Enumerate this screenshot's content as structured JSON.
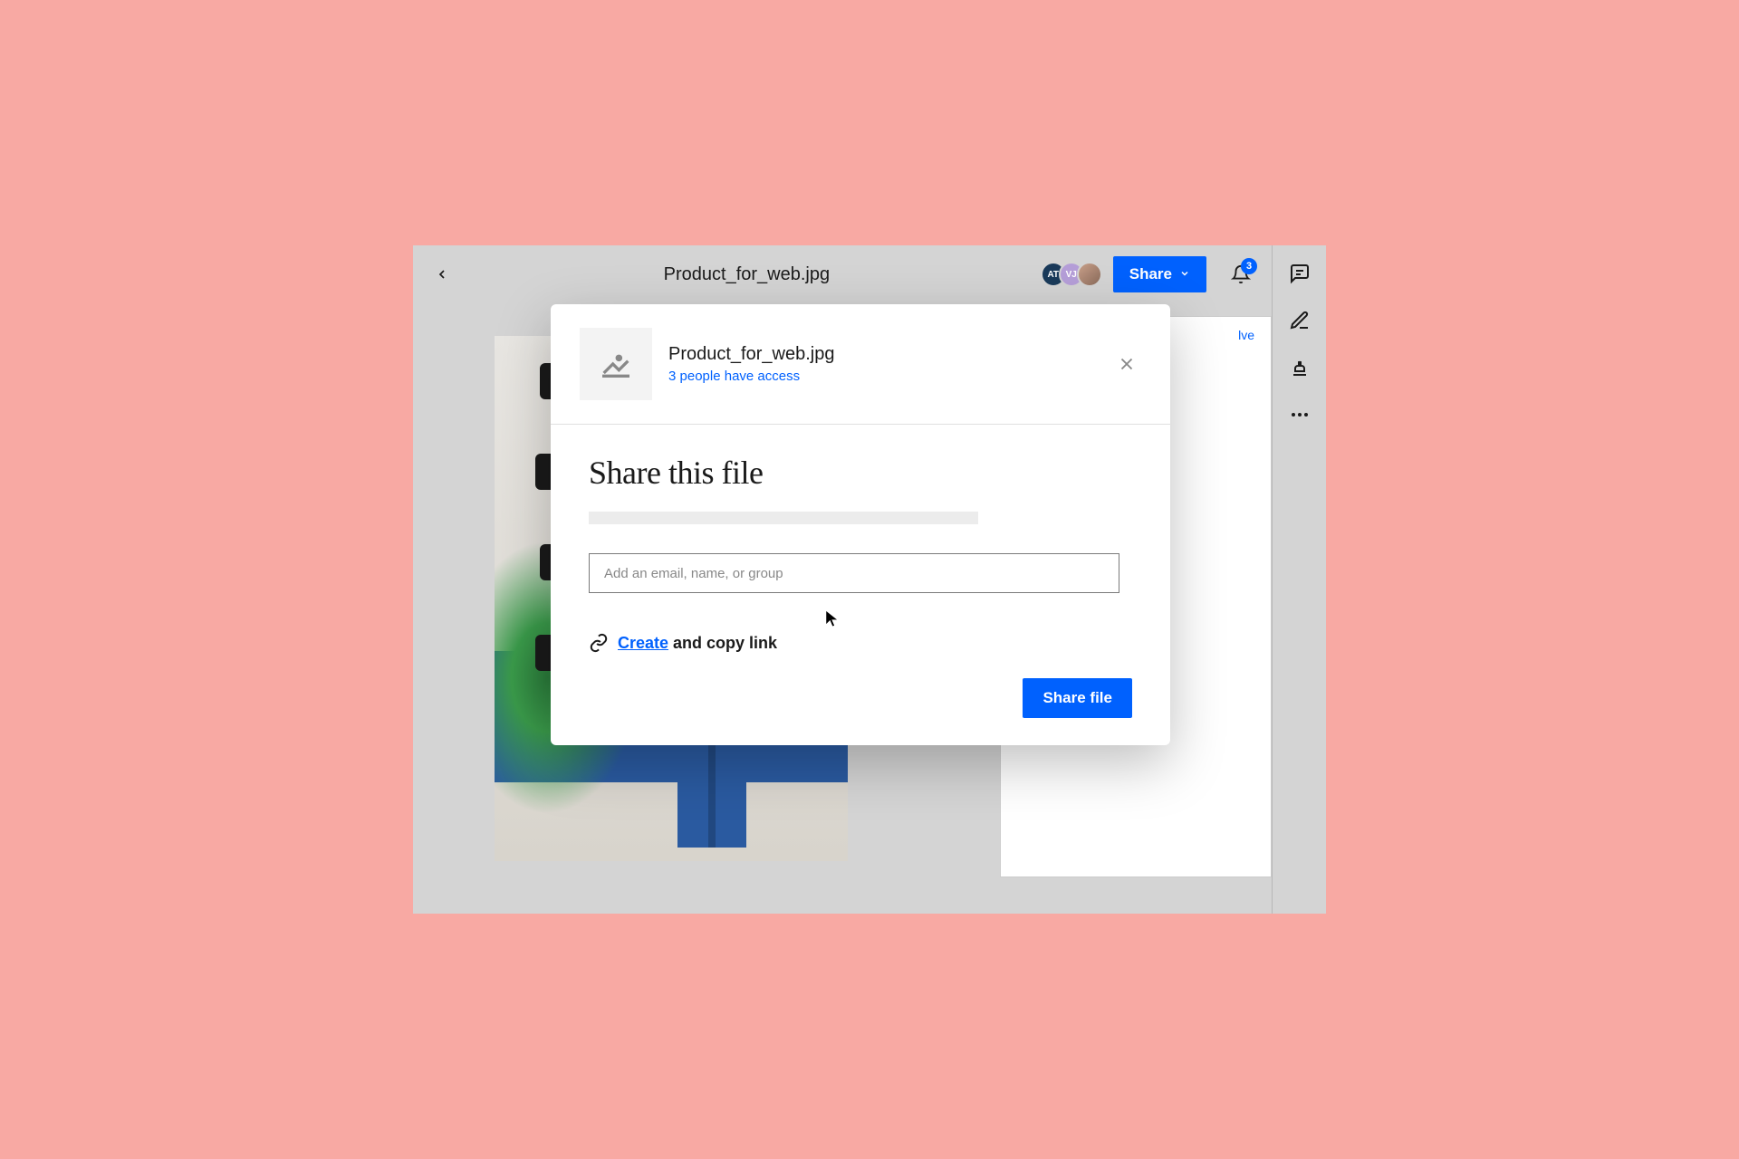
{
  "topbar": {
    "file_name": "Product_for_web.jpg",
    "share_label": "Share",
    "avatars": [
      {
        "initials": "AT"
      },
      {
        "initials": "VJ"
      },
      {
        "initials": ""
      }
    ],
    "notification_count": "3"
  },
  "comment_panel": {
    "resolve_label": "lve"
  },
  "modal": {
    "file_name": "Product_for_web.jpg",
    "access_text": "3 people have access",
    "title": "Share this file",
    "input_placeholder": "Add an email, name, or group",
    "link_create_label": "Create",
    "link_rest_label": " and copy link",
    "share_button_label": "Share file"
  },
  "icons": {
    "back": "chevron-left-icon",
    "bell": "bell-icon",
    "comments": "comments-icon",
    "edit": "edit-icon",
    "stamp": "stamp-icon",
    "more": "more-icon",
    "image_thumb": "image-icon",
    "close": "close-icon",
    "link": "link-icon"
  }
}
